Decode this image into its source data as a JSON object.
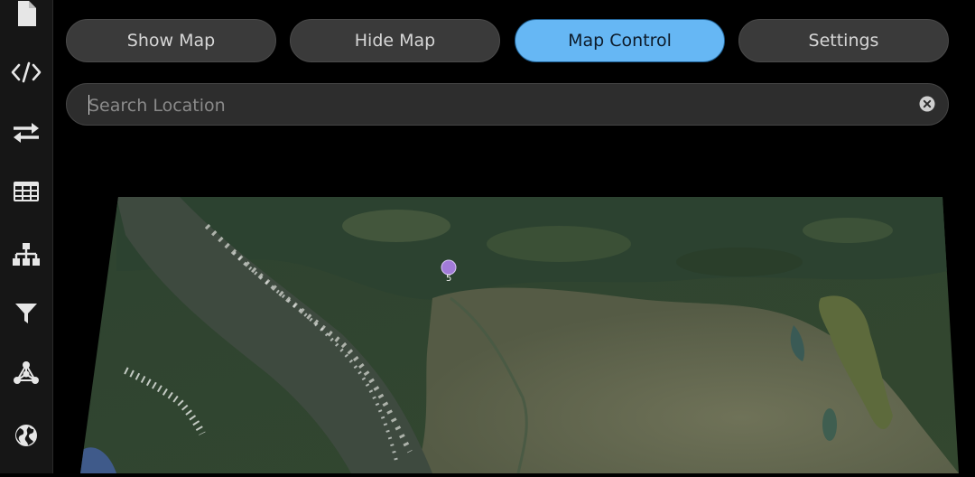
{
  "sidebar": {
    "items": [
      {
        "name": "document-icon"
      },
      {
        "name": "code-icon"
      },
      {
        "name": "transfer-icon"
      },
      {
        "name": "table-icon"
      },
      {
        "name": "hierarchy-icon"
      },
      {
        "name": "filter-icon"
      },
      {
        "name": "network-icon"
      },
      {
        "name": "globe-icon"
      }
    ]
  },
  "tabs": {
    "show_map": "Show Map",
    "hide_map": "Hide Map",
    "map_control": "Map Control",
    "settings": "Settings",
    "active": "Map Control"
  },
  "search": {
    "placeholder": "Search Location",
    "value": ""
  },
  "map": {
    "marker_label": "5",
    "marker_color": "#a27bd8"
  },
  "colors": {
    "accent": "#66b7f4",
    "tab_bg": "#3a3a3a",
    "sidebar_bg": "#161616"
  }
}
